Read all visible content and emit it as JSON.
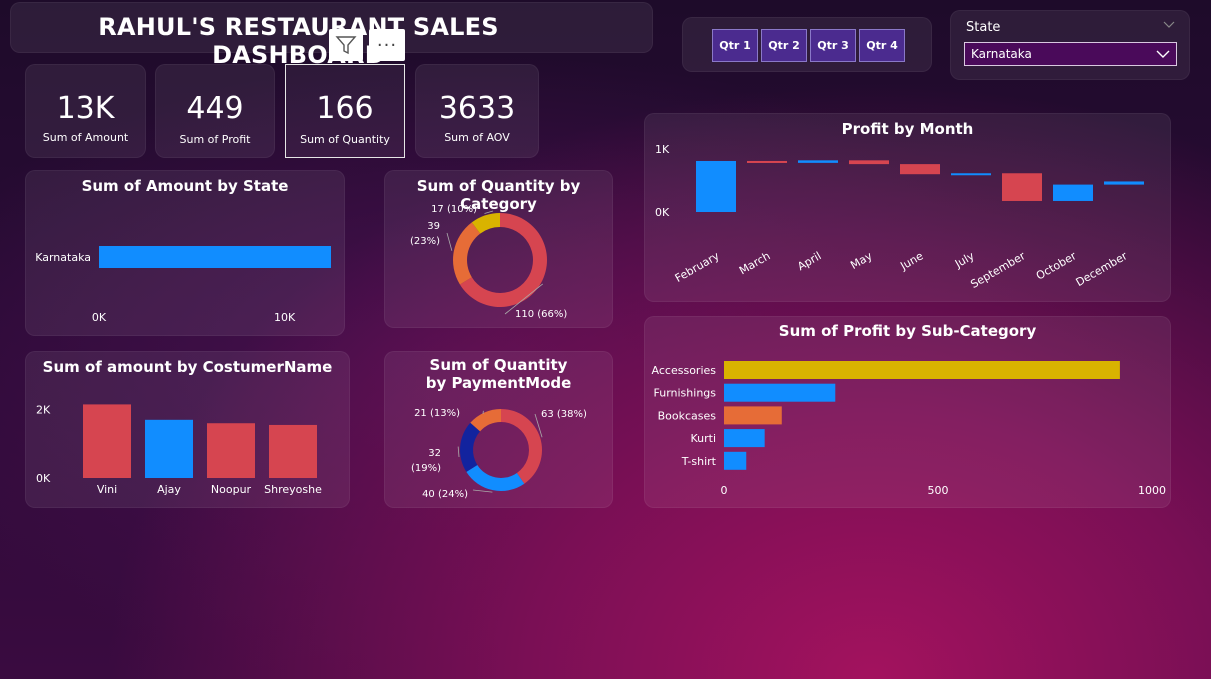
{
  "title": "RAHUL'S RESTAURANT  SALES DASHBOARD",
  "toolbar": {
    "more_label": "···"
  },
  "kpis": [
    {
      "value": "13K",
      "label": "Sum of Amount"
    },
    {
      "value": "449",
      "label": "Sum of Profit"
    },
    {
      "value": "166",
      "label": "Sum of Quantity"
    },
    {
      "value": "3633",
      "label": "Sum of AOV"
    }
  ],
  "quarters": [
    "Qtr 1",
    "Qtr 2",
    "Qtr 3",
    "Qtr 4"
  ],
  "state_filter": {
    "label": "State",
    "selected": "Karnataka"
  },
  "colors": {
    "blue": "#118DFF",
    "red": "#D64550",
    "orange": "#E66C37",
    "yellow": "#D9B300",
    "navy": "#12239E"
  },
  "chart_data": [
    {
      "id": "amount_by_state",
      "type": "bar",
      "orientation": "horizontal",
      "title": "Sum of Amount by State",
      "categories": [
        "Karnataka"
      ],
      "values": [
        12500
      ],
      "xlim": [
        0,
        12500
      ],
      "xticks": [
        0,
        10000
      ],
      "xtick_labels": [
        "0K",
        "10K"
      ]
    },
    {
      "id": "quantity_by_category",
      "type": "pie",
      "donut": true,
      "title": "Sum of Quantity by Category",
      "slices": [
        {
          "value": 110,
          "label": "110 (66%)",
          "color": "#D64550"
        },
        {
          "value": 39,
          "label": "39 (23%)",
          "color": "#E66C37"
        },
        {
          "value": 17,
          "label": "17 (10%)",
          "color": "#D9B300"
        }
      ]
    },
    {
      "id": "amount_by_customer",
      "type": "bar",
      "title": "Sum of amount by CostumerName",
      "categories": [
        "Vini",
        "Ajay",
        "Noopur",
        "Shreyoshe"
      ],
      "values": [
        2150,
        1700,
        1600,
        1550
      ],
      "colors": [
        "#D64550",
        "#118DFF",
        "#D64550",
        "#D64550"
      ],
      "ylim": [
        0,
        2600
      ],
      "yticks": [
        0,
        2000
      ],
      "ytick_labels": [
        "0K",
        "2K"
      ]
    },
    {
      "id": "quantity_by_payment",
      "type": "pie",
      "donut": true,
      "title": "Sum of Quantity by PaymentMode",
      "slices": [
        {
          "value": 63,
          "label": "63 (38%)",
          "color": "#D64550"
        },
        {
          "value": 40,
          "label": "40 (24%)",
          "color": "#118DFF"
        },
        {
          "value": 32,
          "label": "32 (19%)",
          "color": "#12239E"
        },
        {
          "value": 21,
          "label": "21 (13%)",
          "color": "#E66C37"
        }
      ]
    },
    {
      "id": "profit_by_month",
      "type": "waterfall",
      "title": "Profit by Month",
      "categories": [
        "February",
        "March",
        "April",
        "May",
        "June",
        "July",
        "September",
        "October",
        "December"
      ],
      "changes": [
        810,
        -30,
        40,
        -60,
        -160,
        15,
        -440,
        260,
        50
      ],
      "yticks": [
        0,
        1000
      ],
      "ytick_labels": [
        "0K",
        "1K"
      ]
    },
    {
      "id": "profit_by_subcategory",
      "type": "bar",
      "orientation": "horizontal",
      "title": "Sum of Profit by Sub-Category",
      "categories": [
        "Accessories",
        "Furnishings",
        "Bookcases",
        "Kurti",
        "T-shirt"
      ],
      "values": [
        925,
        260,
        135,
        95,
        52
      ],
      "colors": [
        "#D9B300",
        "#118DFF",
        "#E66C37",
        "#118DFF",
        "#118DFF"
      ],
      "xlim": [
        0,
        1000
      ],
      "xticks": [
        0,
        500,
        1000
      ],
      "xtick_labels": [
        "0",
        "500",
        "1000"
      ]
    }
  ]
}
